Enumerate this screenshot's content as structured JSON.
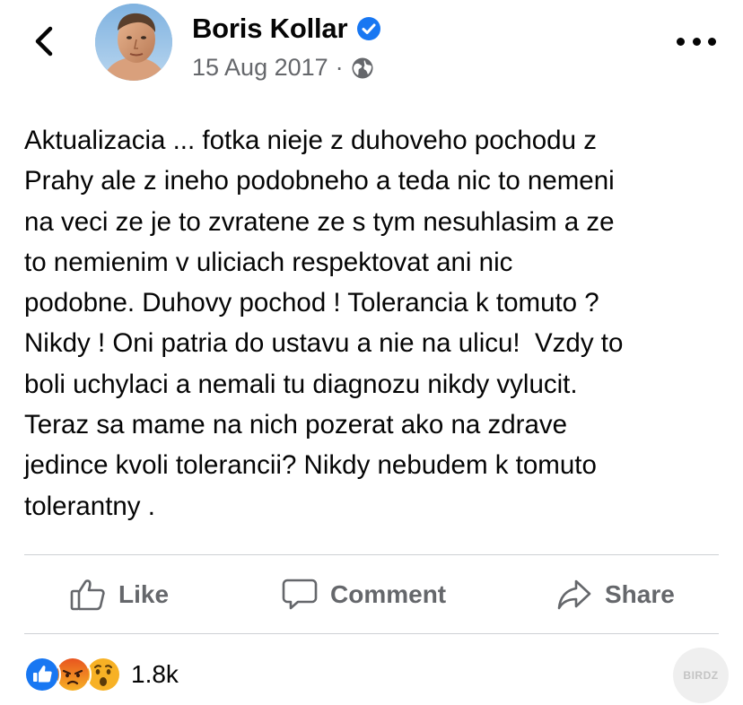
{
  "header": {
    "author_name": "Boris Kollar",
    "date": "15 Aug 2017",
    "separator": "·",
    "icons": {
      "back": "chevron-left-icon",
      "verified": "verified-badge-icon",
      "privacy": "globe-icon",
      "more": "more-dots-icon"
    }
  },
  "post": {
    "text": "Aktualizacia ... fotka nieje z duhoveho pochodu z\nPrahy ale z ineho podobneho a teda nic to nemeni\nna veci ze je to zvratene ze s tym nesuhlasim a ze\nto nemienim v uliciach respektovat ani nic\npodobne. Duhovy pochod ! Tolerancia k tomuto ?\nNikdy ! Oni patria do ustavu a nie na ulicu!  Vzdy to\nboli uchylaci a nemali tu diagnozu nikdy vylucit.\nTeraz sa mame na nich pozerat ako na zdrave\njedince kvoli tolerancii? Nikdy nebudem k tomuto\ntolerantny ."
  },
  "actions": {
    "like_label": "Like",
    "comment_label": "Comment",
    "share_label": "Share"
  },
  "reactions": {
    "types": [
      "like",
      "angry",
      "wow"
    ],
    "count": "1.8k"
  },
  "watermark": {
    "text": "BIRDZ"
  },
  "colors": {
    "verified_blue": "#1877f2",
    "like_blue": "#1877f2",
    "angry_orange": "#e9710f",
    "wow_yellow": "#f7b125",
    "secondary_text": "#65676b",
    "divider": "#ced0d4"
  }
}
